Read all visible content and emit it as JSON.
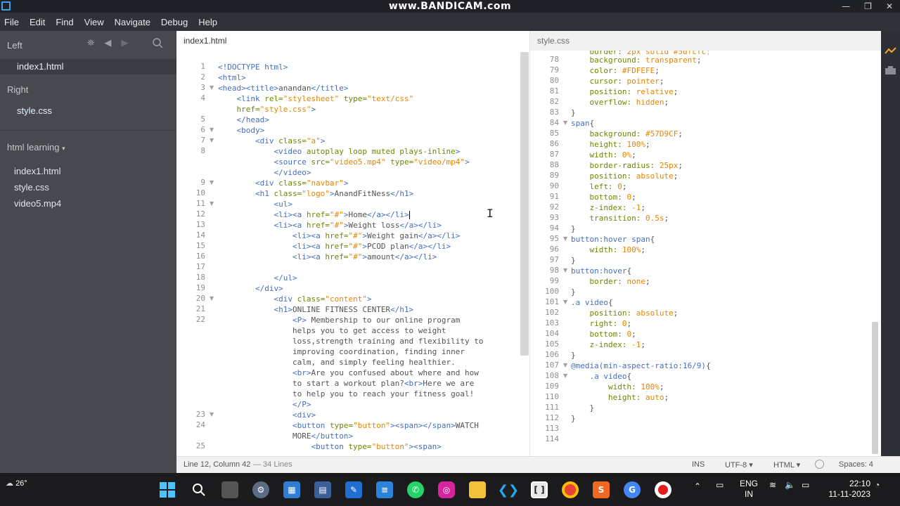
{
  "titlebar": {
    "watermark": "www.BANDICAM.com",
    "controls": [
      "—",
      "❐",
      "✕"
    ]
  },
  "menubar": {
    "items": [
      "File",
      "Edit",
      "Find",
      "View",
      "Navigate",
      "Debug",
      "Help"
    ]
  },
  "sidebar": {
    "left_label": "Left",
    "left_file": "index1.html",
    "right_label": "Right",
    "right_file": "style.css",
    "project": "html learning",
    "project_arrow": "▾",
    "files": [
      "index1.html",
      "style.css",
      "video5.mp4"
    ]
  },
  "left_pane": {
    "tab": "index1.html",
    "lines": [
      {
        "n": "1",
        "fold": false,
        "html": "<span class=\"tok-tag\">&lt;!DOCTYPE html&gt;</span>"
      },
      {
        "n": "2",
        "fold": false,
        "html": "<span class=\"tok-tag\">&lt;html&gt;</span>"
      },
      {
        "n": "3",
        "fold": true,
        "html": "<span class=\"tok-tag\">&lt;head&gt;&lt;title&gt;</span>anandan<span class=\"tok-tag\">&lt;/title&gt;</span>"
      },
      {
        "n": "4",
        "fold": false,
        "html": "    <span class=\"tok-tag\">&lt;link</span> <span class=\"tok-attr\">rel=</span><span class=\"tok-str\">\"stylesheet\"</span> <span class=\"tok-attr\">type=</span><span class=\"tok-str\">\"text/css\"</span>"
      },
      {
        "n": "",
        "fold": false,
        "html": "    <span class=\"tok-attr\">href=</span><span class=\"tok-str\">\"style.css\"</span><span class=\"tok-tag\">&gt;</span>"
      },
      {
        "n": "5",
        "fold": false,
        "html": "    <span class=\"tok-tag\">&lt;/head&gt;</span>"
      },
      {
        "n": "6",
        "fold": true,
        "html": "    <span class=\"tok-tag\">&lt;body&gt;</span>"
      },
      {
        "n": "7",
        "fold": true,
        "html": "        <span class=\"tok-tag\">&lt;div</span> <span class=\"tok-attr\">class=</span><span class=\"tok-str\">\"a\"</span><span class=\"tok-tag\">&gt;</span>"
      },
      {
        "n": "8",
        "fold": false,
        "html": "            <span class=\"tok-tag\">&lt;video</span> <span class=\"tok-attr\">autoplay loop muted plays-inline</span><span class=\"tok-tag\">&gt;</span>"
      },
      {
        "n": "",
        "fold": false,
        "html": "            <span class=\"tok-tag\">&lt;source</span> <span class=\"tok-attr\">src=</span><span class=\"tok-str\">\"video5.mp4\"</span> <span class=\"tok-attr\">type=</span><span class=\"tok-str\">\"video/mp4\"</span><span class=\"tok-tag\">&gt;</span>"
      },
      {
        "n": "",
        "fold": false,
        "html": "            <span class=\"tok-tag\">&lt;/video&gt;</span>"
      },
      {
        "n": "9",
        "fold": true,
        "html": "        <span class=\"tok-tag\">&lt;div</span> <span class=\"tok-attr\">class=</span><span class=\"tok-str\">\"navbar\"</span><span class=\"tok-tag\">&gt;</span>"
      },
      {
        "n": "10",
        "fold": false,
        "html": "        <span class=\"tok-tag\">&lt;h1</span> <span class=\"tok-attr\">class=</span><span class=\"tok-str\">\"logo\"</span><span class=\"tok-tag\">&gt;</span>AnandFitNess<span class=\"tok-tag\">&lt;/h1&gt;</span>"
      },
      {
        "n": "11",
        "fold": true,
        "html": "            <span class=\"tok-tag\">&lt;ul&gt;</span>"
      },
      {
        "n": "12",
        "fold": false,
        "html": "            <span class=\"tok-tag\">&lt;li&gt;&lt;a</span> <span class=\"tok-attr\">href=</span><span class=\"tok-str\">\"#\"</span><span class=\"tok-tag\">&gt;</span>Home<span class=\"tok-tag\">&lt;/a&gt;&lt;/li&gt;</span><span class=\"caret\"></span>"
      },
      {
        "n": "13",
        "fold": false,
        "html": "            <span class=\"tok-tag\">&lt;li&gt;&lt;a</span> <span class=\"tok-attr\">href=</span><span class=\"tok-str\">\"#\"</span><span class=\"tok-tag\">&gt;</span>Weight loss<span class=\"tok-tag\">&lt;/a&gt;&lt;/li&gt;</span>"
      },
      {
        "n": "14",
        "fold": false,
        "html": "                <span class=\"tok-tag\">&lt;li&gt;&lt;a</span> <span class=\"tok-attr\">href=</span><span class=\"tok-str\">\"#\"</span><span class=\"tok-tag\">&gt;</span>Weight gain<span class=\"tok-tag\">&lt;/a&gt;&lt;/li&gt;</span>"
      },
      {
        "n": "15",
        "fold": false,
        "html": "                <span class=\"tok-tag\">&lt;li&gt;&lt;a</span> <span class=\"tok-attr\">href=</span><span class=\"tok-str\">\"#\"</span><span class=\"tok-tag\">&gt;</span>PCOD plan<span class=\"tok-tag\">&lt;/a&gt;&lt;/li&gt;</span>"
      },
      {
        "n": "16",
        "fold": false,
        "html": "                <span class=\"tok-tag\">&lt;li&gt;&lt;a</span> <span class=\"tok-attr\">href=</span><span class=\"tok-str\">\"#\"</span><span class=\"tok-tag\">&gt;</span>amount<span class=\"tok-tag\">&lt;/a&gt;&lt;/li&gt;</span>"
      },
      {
        "n": "17",
        "fold": false,
        "html": ""
      },
      {
        "n": "18",
        "fold": false,
        "html": "            <span class=\"tok-tag\">&lt;/ul&gt;</span>"
      },
      {
        "n": "19",
        "fold": false,
        "html": "        <span class=\"tok-tag\">&lt;/div&gt;</span>"
      },
      {
        "n": "20",
        "fold": true,
        "html": "            <span class=\"tok-tag\">&lt;div</span> <span class=\"tok-attr\">class=</span><span class=\"tok-str\">\"content\"</span><span class=\"tok-tag\">&gt;</span>"
      },
      {
        "n": "21",
        "fold": false,
        "html": "            <span class=\"tok-tag\">&lt;h1&gt;</span>ONLINE FITNESS CENTER<span class=\"tok-tag\">&lt;/h1&gt;</span>"
      },
      {
        "n": "22",
        "fold": false,
        "html": "                <span class=\"tok-tag\">&lt;P&gt;</span> Membership to our online program"
      },
      {
        "n": "",
        "fold": false,
        "html": "                helps you to get access to weight"
      },
      {
        "n": "",
        "fold": false,
        "html": "                loss,strength training and flexibility to"
      },
      {
        "n": "",
        "fold": false,
        "html": "                improving coordination, finding inner"
      },
      {
        "n": "",
        "fold": false,
        "html": "                calm, and simply feeling healthier."
      },
      {
        "n": "",
        "fold": false,
        "html": "                <span class=\"tok-tag\">&lt;br&gt;</span>Are you confused about where and how"
      },
      {
        "n": "",
        "fold": false,
        "html": "                to start a workout plan?<span class=\"tok-tag\">&lt;br&gt;</span>Here we are"
      },
      {
        "n": "",
        "fold": false,
        "html": "                to help you to reach your fitness goal!"
      },
      {
        "n": "",
        "fold": false,
        "html": "                <span class=\"tok-tag\">&lt;/P&gt;</span>"
      },
      {
        "n": "23",
        "fold": true,
        "html": "                <span class=\"tok-tag\">&lt;div&gt;</span>"
      },
      {
        "n": "24",
        "fold": false,
        "html": "                <span class=\"tok-tag\">&lt;button</span> <span class=\"tok-attr\">type=</span><span class=\"tok-str\">\"button\"</span><span class=\"tok-tag\">&gt;&lt;span&gt;&lt;/span&gt;</span>WATCH"
      },
      {
        "n": "",
        "fold": false,
        "html": "                MORE<span class=\"tok-tag\">&lt;/button&gt;</span>"
      },
      {
        "n": "25",
        "fold": false,
        "html": "                    <span class=\"tok-tag\">&lt;button</span> <span class=\"tok-attr\">type=</span><span class=\"tok-str\">\"button\"</span><span class=\"tok-tag\">&gt;&lt;span&gt;</span>"
      }
    ]
  },
  "right_pane": {
    "tab": "style.css",
    "lines": [
      {
        "n": "78",
        "fold": false,
        "html": "    <span class=\"tok-prop\">background:</span> <span class=\"tok-val\">transparent</span>;"
      },
      {
        "n": "79",
        "fold": false,
        "html": "    <span class=\"tok-prop\">color:</span> <span class=\"tok-val\">#FDFEFE</span>;"
      },
      {
        "n": "80",
        "fold": false,
        "html": "    <span class=\"tok-prop\">cursor:</span> <span class=\"tok-val\">pointer</span>;"
      },
      {
        "n": "81",
        "fold": false,
        "html": "    <span class=\"tok-prop\">position:</span> <span class=\"tok-val\">relative</span>;"
      },
      {
        "n": "82",
        "fold": false,
        "html": "    <span class=\"tok-prop\">overflow:</span> <span class=\"tok-val\">hidden</span>;"
      },
      {
        "n": "83",
        "fold": false,
        "html": "}"
      },
      {
        "n": "84",
        "fold": true,
        "html": "<span class=\"tok-sel\">span</span>{"
      },
      {
        "n": "85",
        "fold": false,
        "html": "    <span class=\"tok-prop\">background:</span> <span class=\"tok-val\">#57D9CF</span>;"
      },
      {
        "n": "86",
        "fold": false,
        "html": "    <span class=\"tok-prop\">height:</span> <span class=\"tok-val\">100%</span>;"
      },
      {
        "n": "87",
        "fold": false,
        "html": "    <span class=\"tok-prop\">width:</span> <span class=\"tok-val\">0%</span>;"
      },
      {
        "n": "88",
        "fold": false,
        "html": "    <span class=\"tok-prop\">border-radius:</span> <span class=\"tok-val\">25px</span>;"
      },
      {
        "n": "89",
        "fold": false,
        "html": "    <span class=\"tok-prop\">position:</span> <span class=\"tok-val\">absolute</span>;"
      },
      {
        "n": "90",
        "fold": false,
        "html": "    <span class=\"tok-prop\">left:</span> <span class=\"tok-val\">0</span>;"
      },
      {
        "n": "91",
        "fold": false,
        "html": "    <span class=\"tok-prop\">bottom:</span> <span class=\"tok-val\">0</span>;"
      },
      {
        "n": "92",
        "fold": false,
        "html": "    <span class=\"tok-prop\">z-index:</span> <span class=\"tok-val\">-1</span>;"
      },
      {
        "n": "93",
        "fold": false,
        "html": "    <span class=\"tok-prop\">transition:</span> <span class=\"tok-val\">0.5s</span>;"
      },
      {
        "n": "94",
        "fold": false,
        "html": "}"
      },
      {
        "n": "95",
        "fold": true,
        "html": "<span class=\"tok-sel\">button:hover span</span>{"
      },
      {
        "n": "96",
        "fold": false,
        "html": "    <span class=\"tok-prop\">width:</span> <span class=\"tok-val\">100%</span>;"
      },
      {
        "n": "97",
        "fold": false,
        "html": "}"
      },
      {
        "n": "98",
        "fold": true,
        "html": "<span class=\"tok-sel\">button:hover</span>{"
      },
      {
        "n": "99",
        "fold": false,
        "html": "    <span class=\"tok-prop\">border:</span> <span class=\"tok-val\">none</span>;"
      },
      {
        "n": "100",
        "fold": false,
        "html": "}"
      },
      {
        "n": "101",
        "fold": true,
        "html": "<span class=\"tok-sel\">.a video</span>{"
      },
      {
        "n": "102",
        "fold": false,
        "html": "    <span class=\"tok-prop\">position:</span> <span class=\"tok-val\">absolute</span>;"
      },
      {
        "n": "103",
        "fold": false,
        "html": "    <span class=\"tok-prop\">right:</span> <span class=\"tok-val\">0</span>;"
      },
      {
        "n": "104",
        "fold": false,
        "html": "    <span class=\"tok-prop\">bottom:</span> <span class=\"tok-val\">0</span>;"
      },
      {
        "n": "105",
        "fold": false,
        "html": "    <span class=\"tok-prop\">z-index:</span> <span class=\"tok-val\">-1</span>;"
      },
      {
        "n": "106",
        "fold": false,
        "html": "}"
      },
      {
        "n": "107",
        "fold": true,
        "html": "<span class=\"tok-sel\">@media(min-aspect-ratio:16/9)</span>{"
      },
      {
        "n": "108",
        "fold": true,
        "html": "    <span class=\"tok-sel\">.a video</span>{"
      },
      {
        "n": "109",
        "fold": false,
        "html": "        <span class=\"tok-prop\">width:</span> <span class=\"tok-val\">100%</span>;"
      },
      {
        "n": "110",
        "fold": false,
        "html": "        <span class=\"tok-prop\">height:</span> <span class=\"tok-val\">auto</span>;"
      },
      {
        "n": "111",
        "fold": false,
        "html": "    }"
      },
      {
        "n": "112",
        "fold": false,
        "html": "}"
      },
      {
        "n": "113",
        "fold": false,
        "html": ""
      },
      {
        "n": "114",
        "fold": false,
        "html": ""
      }
    ]
  },
  "statusbar": {
    "position": "Line 12, Column 42",
    "lines_count": "— 34 Lines",
    "mode": "INS",
    "encoding": "UTF-8 ▾",
    "language": "HTML ▾",
    "spaces": "Spaces: 4"
  },
  "taskbar": {
    "temperature": "26°",
    "lang_top": "ENG",
    "lang_bottom": "IN",
    "time": "22:10",
    "date": "11-11-2023"
  },
  "colors": {
    "sidebar_bg": "#47494f",
    "menubar_bg": "#2f3238",
    "accent": "#446fbd"
  }
}
